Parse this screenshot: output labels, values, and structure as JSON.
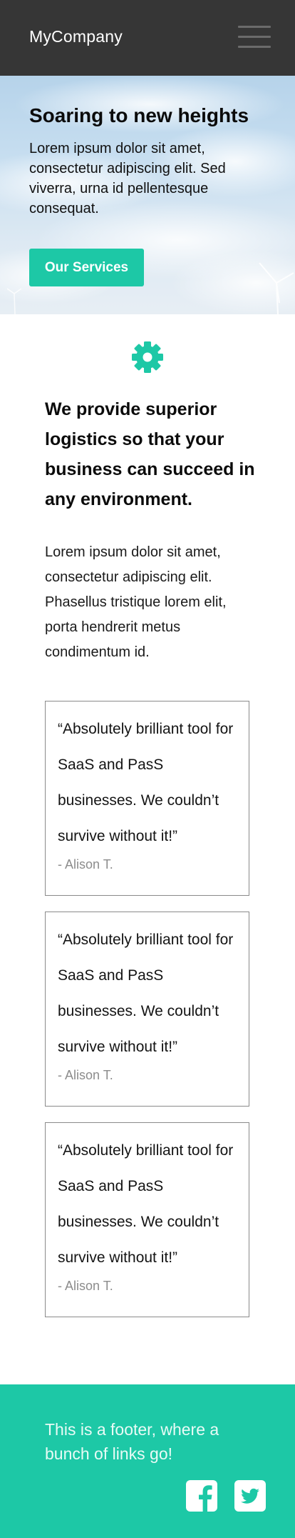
{
  "header": {
    "brand": "MyCompany",
    "menu_icon": "hamburger-menu-icon"
  },
  "hero": {
    "title": "Soaring to new heights",
    "text": "Lorem ipsum dolor sit amet, consectetur adipiscing elit. Sed viverra, urna id pellentesque consequat.",
    "button_label": "Our Services"
  },
  "main": {
    "icon": "gear-icon",
    "mission": "We provide superior logistics so that your business can succeed in any environment.",
    "body": "Lorem ipsum dolor sit amet, consectetur adipiscing elit. Phasellus tristique lorem elit, porta hendrerit metus condimentum id."
  },
  "testimonials": [
    {
      "quote": "“Absolutely brilliant tool for SaaS and PasS businesses. We couldn’t survive without it!”",
      "author": "- Alison T."
    },
    {
      "quote": "“Absolutely brilliant tool for SaaS and PasS businesses. We couldn’t survive without it!”",
      "author": "- Alison T."
    },
    {
      "quote": "“Absolutely brilliant tool for SaaS and PasS businesses. We couldn’t survive without it!”",
      "author": "- Alison T."
    }
  ],
  "footer": {
    "text": "This is a footer, where a bunch of links go!",
    "social_icons": [
      "facebook-icon",
      "twitter-icon"
    ]
  },
  "colors": {
    "header_bg": "#363636",
    "accent": "#1dc8a6",
    "testimonial_border": "#8a8a8a"
  }
}
